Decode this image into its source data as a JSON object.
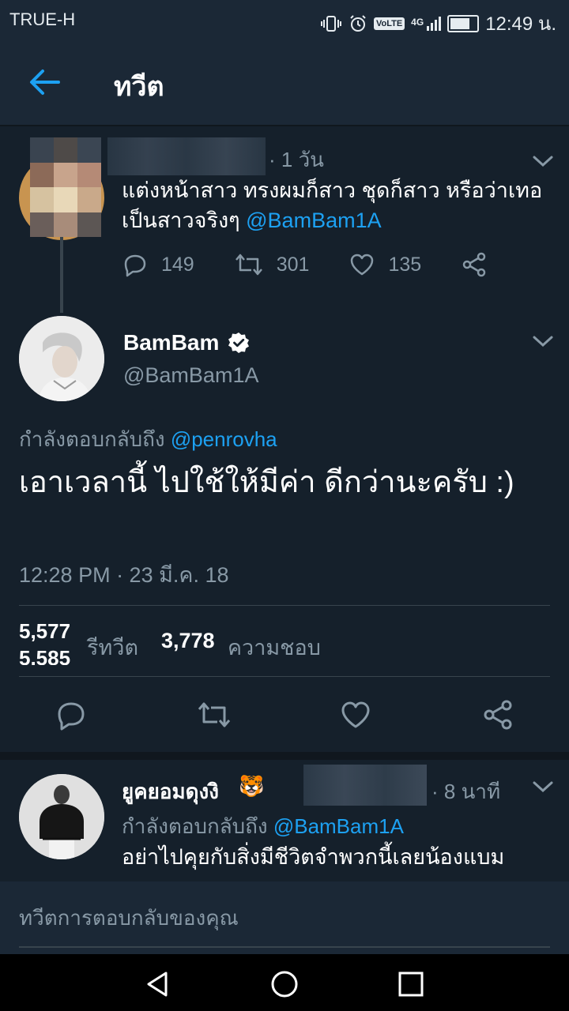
{
  "status_bar": {
    "carrier": "TRUE-H",
    "icons": [
      "vibrate-icon",
      "alarm-icon",
      "volte-icon",
      "signal-4g-icon",
      "battery-icon"
    ],
    "volte_label": "VoLTE",
    "network_label": "4G",
    "battery_level": 0.85,
    "time": "12:49 น."
  },
  "header": {
    "title": "ทวีต",
    "back_icon": "arrow-left-icon"
  },
  "parent_tweet": {
    "time": "· 1 วัน",
    "text": "แต่งหน้าสาว ทรงผมก็สาว ชุดก็สาว หรือว่าเทอเป็นสาวจริงๆ ",
    "mention": "@BamBam1A",
    "replies": "149",
    "retweets": "301",
    "likes": "135"
  },
  "main_tweet": {
    "name": "BamBam",
    "handle": "@BamBam1A",
    "replying_label": "กำลังตอบกลับถึง ",
    "replying_to": "@penrovha",
    "text": "เอาเวลานี้ ไปใช้ให้มีค่า ดีกว่านะครับ :)",
    "timestamp": "12:28 PM · 23 มี.ค. 18",
    "retweet_count_old": "5,577",
    "retweet_count_new": "5,585",
    "retweet_label": "รีทวีต",
    "like_count": "3,778",
    "like_label": "ความชอบ"
  },
  "reply_tweet": {
    "name": "ยูคยอมดุงงิ",
    "emoji": "🐯",
    "time": "· 8 นาที",
    "replying_label": "กำลังตอบกลับถึง ",
    "replying_to": "@BamBam1A",
    "text": "อย่าไปคุยกับสิ่งมีชีวิตจำพวกนี้เลยน้องแบม"
  },
  "compose": {
    "placeholder": "ทวีตการตอบกลับของคุณ"
  },
  "colors": {
    "background": "#15202b",
    "accent": "#1da1f2",
    "muted": "#8899a6"
  }
}
